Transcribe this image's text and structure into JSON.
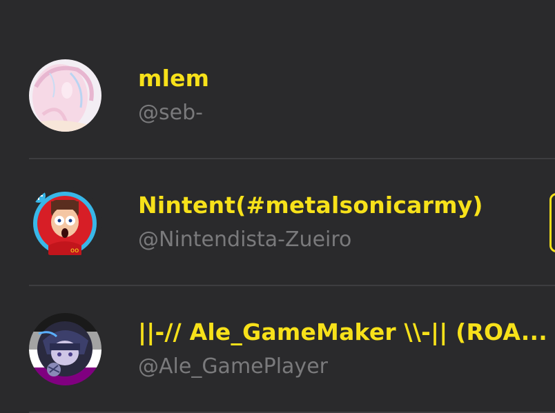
{
  "users": [
    {
      "display_name": "mlem",
      "username": "@seb-",
      "avatar": "pastel-portrait-avatar"
    },
    {
      "display_name": "Nintent(#metalsonicarmy)",
      "username": "@Nintendista-Zueiro",
      "avatar": "cartoon-boy-avatar"
    },
    {
      "display_name": "||-// Ale_GameMaker \\\\-|| (ROA...",
      "username": "@Ale_GamePlayer",
      "avatar": "purple-hoodie-avatar"
    }
  ],
  "colors": {
    "background": "#2a2a2c",
    "display_name": "#f7e11a",
    "username": "#7a7a7c",
    "divider": "#3d3d40"
  }
}
